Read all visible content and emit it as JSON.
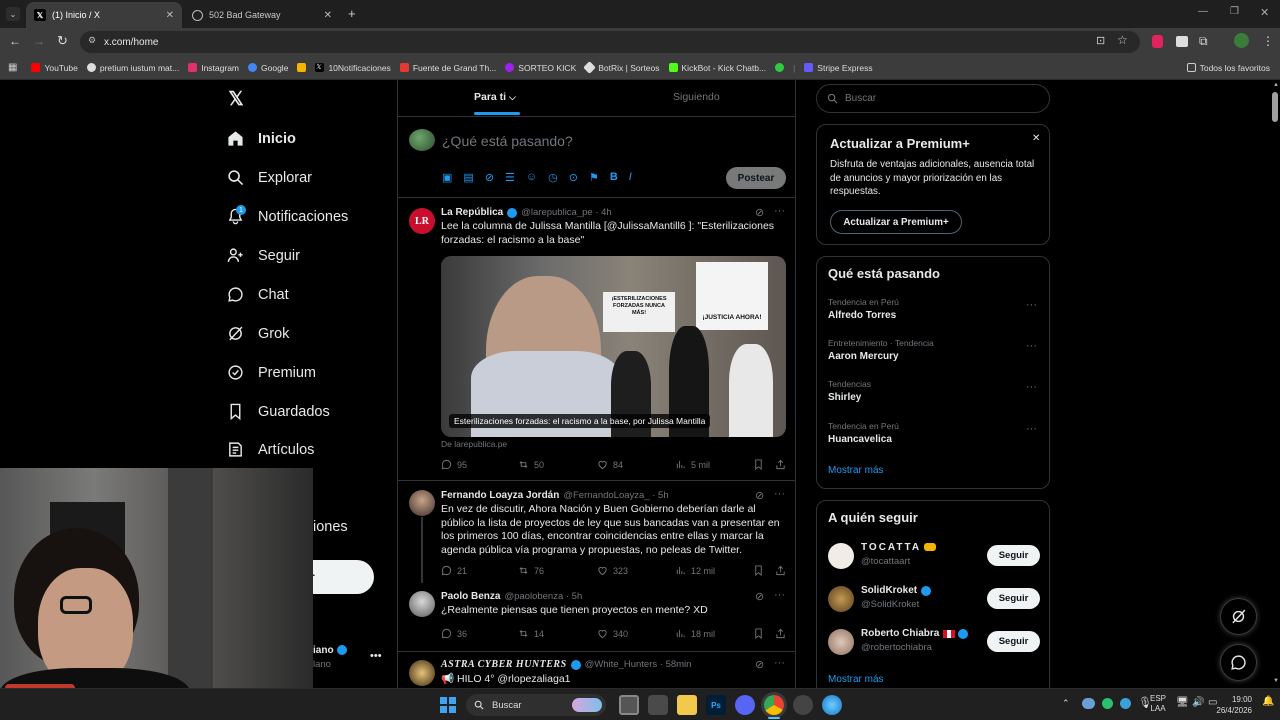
{
  "browser": {
    "tabs": [
      {
        "title": "(1) Inicio / X",
        "active": true
      },
      {
        "title": "502 Bad Gateway",
        "active": false
      }
    ],
    "url": "x.com/home",
    "bookmarks": [
      {
        "label": "YouTube",
        "color": "#ff0000"
      },
      {
        "label": "pretium iustum mat...",
        "color": "#dddddd"
      },
      {
        "label": "Instagram",
        "color": "#e1306c"
      },
      {
        "label": "Google",
        "color": "#4285f4"
      },
      {
        "label": "",
        "color": "#f4b400"
      },
      {
        "label": "10Notificaciones",
        "color": "#000000"
      },
      {
        "label": "Fuente de Grand Th...",
        "color": "#e53935"
      },
      {
        "label": "SORTEO KICK",
        "color": "#a020f0"
      },
      {
        "label": "BotRix | Sorteos",
        "color": "#dddddd"
      },
      {
        "label": "KickBot - Kick Chatb...",
        "color": "#53fc18"
      },
      {
        "label": "",
        "color": "#2ecc40"
      },
      {
        "label": "Stripe Express",
        "color": "#635bff"
      }
    ],
    "all_bookmarks": "Todos los favoritos"
  },
  "nav": {
    "items": [
      {
        "label": "Inicio",
        "icon": "home-icon"
      },
      {
        "label": "Explorar",
        "icon": "search-icon"
      },
      {
        "label": "Notificaciones",
        "icon": "bell-icon",
        "badge": "1"
      },
      {
        "label": "Seguir",
        "icon": "person-add-icon"
      },
      {
        "label": "Chat",
        "icon": "chat-icon"
      },
      {
        "label": "Grok",
        "icon": "grok-icon"
      },
      {
        "label": "Premium",
        "icon": "premium-icon"
      },
      {
        "label": "Guardados",
        "icon": "bookmark-icon"
      },
      {
        "label": "Artículos",
        "icon": "article-icon"
      }
    ],
    "partial_label": "iones",
    "partial_button": "r",
    "partial_account_name": "iano",
    "partial_account_handle": "lano"
  },
  "feed": {
    "tab_for_you": "Para ti",
    "tab_following": "Siguiendo",
    "compose_placeholder": "¿Qué está pasando?",
    "post_button": "Postear",
    "posts": [
      {
        "name": "La República",
        "handle": "@larepublica_pe · 4h",
        "text": "Lee la columna de Julissa Mantilla [@JulissaMantill6 ]: \"Esterilizaciones forzadas: el racismo a la base\"",
        "card_caption": "Esterilizaciones forzadas: el racismo a la base, por Julissa Mantilla",
        "card_source": "De larepublica.pe",
        "sign_left": "¡ESTERILIZACIONES FORZADAS NUNCA MÁS!",
        "sign_right": "¡JUSTICIA AHORA!",
        "replies": "95",
        "reposts": "50",
        "likes": "84",
        "views": "5 mil"
      },
      {
        "name": "Fernando Loayza Jordán",
        "handle": "@FernandoLoayza_ · 5h",
        "text": "En vez de discutir, Ahora Nación y Buen Gobierno deberían darle al público la lista de proyectos de ley que sus bancadas van a presentar en los primeros 100 días, encontrar coincidencias entre ellas y marcar la agenda pública vía programa y propuestas, no peleas de Twitter.",
        "replies": "21",
        "reposts": "76",
        "likes": "323",
        "views": "12 mil"
      },
      {
        "name": "Paolo Benza",
        "handle": "@paolobenza · 5h",
        "text": "¿Realmente piensas que tienen proyectos en mente? XD",
        "replies": "36",
        "reposts": "14",
        "likes": "340",
        "views": "18 mil"
      },
      {
        "name": "ASTRA CYBER HUNTERS",
        "handle": "@White_Hunters · 58min",
        "text": "HILO 4° @rlopezaliaga1"
      }
    ]
  },
  "sidebar": {
    "search_placeholder": "Buscar",
    "premium": {
      "title": "Actualizar a Premium+",
      "body": "Disfruta de ventajas adicionales, ausencia total de anuncios y mayor priorización en las respuestas.",
      "button": "Actualizar a Premium+"
    },
    "trends": {
      "title": "Qué está pasando",
      "items": [
        {
          "category": "Tendencia en Perú",
          "name": "Alfredo Torres"
        },
        {
          "category": "Entretenimiento · Tendencia",
          "name": "Aaron Mercury"
        },
        {
          "category": "Tendencias",
          "name": "Shirley"
        },
        {
          "category": "Tendencia en Perú",
          "name": "Huancavelica"
        }
      ],
      "show_more": "Mostrar más"
    },
    "who_to_follow": {
      "title": "A quién seguir",
      "items": [
        {
          "name": "TOCATTA",
          "handle": "@tocattaart"
        },
        {
          "name": "SolidKroket",
          "handle": "@SolidKroket"
        },
        {
          "name": "Roberto Chiabra",
          "handle": "@robertochiabra"
        }
      ],
      "follow_label": "Seguir",
      "show_more": "Mostrar más"
    }
  },
  "taskbar": {
    "search": "Buscar",
    "lang1": "ESP",
    "lang2": "LAA",
    "time": "19:00",
    "date": "26/4/2026"
  },
  "colors": {
    "x_blue": "#1d9bf0",
    "background": "#000000",
    "border": "#2f3336"
  }
}
